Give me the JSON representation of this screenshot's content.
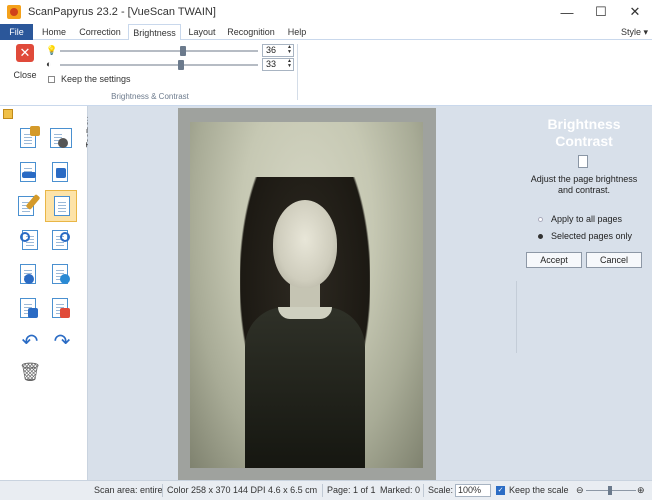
{
  "window": {
    "title": "ScanPapyrus 23.2 - [VueScan TWAIN]",
    "minimize_icon": "minimize-icon",
    "maximize_icon": "maximize-icon",
    "close_icon": "close-icon"
  },
  "tabs": [
    {
      "label": "File",
      "active": false
    },
    {
      "label": "Home",
      "active": false
    },
    {
      "label": "Correction",
      "active": false
    },
    {
      "label": "Brightness",
      "active": true
    },
    {
      "label": "Layout",
      "active": false
    },
    {
      "label": "Recognition",
      "active": false
    },
    {
      "label": "Help",
      "active": false
    }
  ],
  "style_menu": "Style",
  "ribbon": {
    "close_label": "Close",
    "brightness": {
      "value": "36",
      "level": 0.62
    },
    "contrast": {
      "value": "33",
      "level": 0.61
    },
    "keep_settings_label": "Keep the settings",
    "group_label": "Brightness & Contrast"
  },
  "toolbox": {
    "tab_label": "Toolbox"
  },
  "panel": {
    "title_line1": "Brightness",
    "title_line2": "Contrast",
    "description": "Adjust the page brightness and contrast.",
    "options": [
      {
        "label": "Apply to all pages",
        "selected": false
      },
      {
        "label": "Selected pages only",
        "selected": true
      }
    ],
    "accept_label": "Accept",
    "cancel_label": "Cancel"
  },
  "status": {
    "scan_area": "Scan area: entire",
    "color_info": "Color  258 x 370  144 DPI  4.6 x 6.5 cm",
    "page_info": "Page: 1 of 1",
    "marked_info": "Marked: 0",
    "scale_label": "Scale:",
    "scale_value": "100%",
    "keep_scale_label": "Keep the scale"
  },
  "colors": {
    "accent": "#2b579a",
    "close_red": "#e04a3a",
    "selected_tool": "#fde3a8"
  }
}
